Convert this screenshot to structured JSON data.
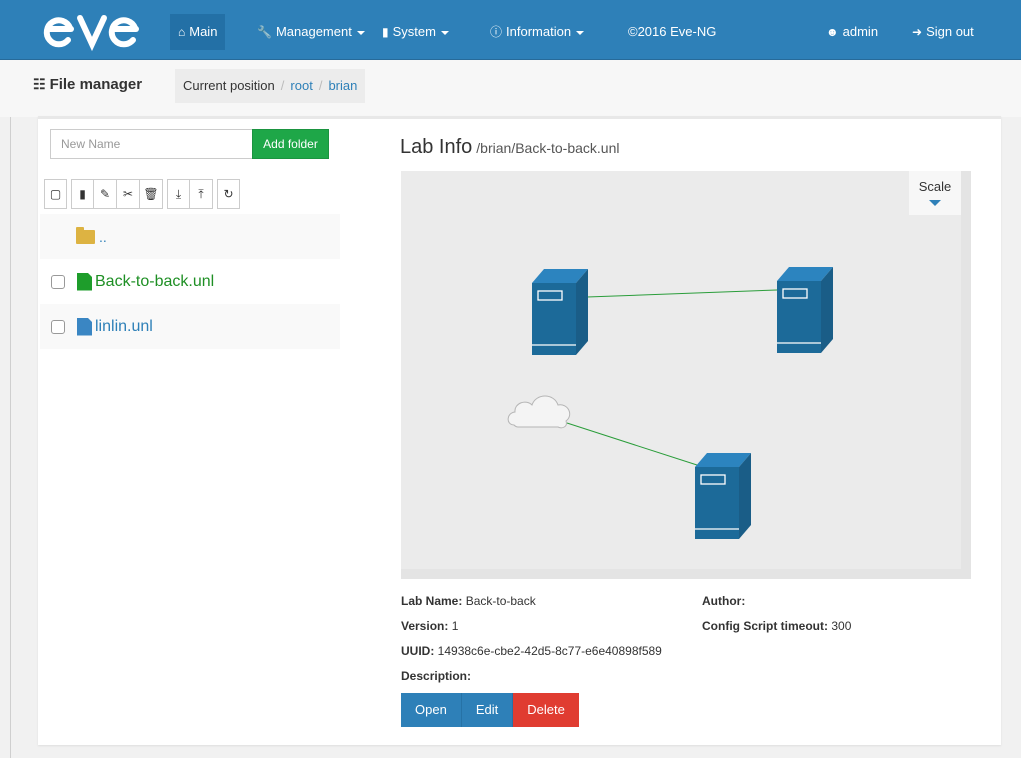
{
  "nav": {
    "logo": "eve",
    "items": [
      {
        "label": "Main",
        "icon": "home-icon"
      },
      {
        "label": "Management",
        "icon": "wrench-icon"
      },
      {
        "label": "System",
        "icon": "book-icon"
      },
      {
        "label": "Information",
        "icon": "info-icon"
      }
    ],
    "copyright": "©2016 Eve-NG",
    "user": "admin",
    "signout": "Sign out"
  },
  "header": {
    "title": "File manager",
    "breadcrumb": {
      "label": "Current position",
      "items": [
        "root",
        "brian"
      ]
    }
  },
  "files": {
    "new_name_placeholder": "New Name",
    "add_folder_label": "Add folder",
    "up_label": "..",
    "items": [
      {
        "name": "Back-to-back.unl",
        "color": "#1e8f24"
      },
      {
        "name": "linlin.unl",
        "color": "#2e80b8"
      }
    ]
  },
  "lab": {
    "title": "Lab Info",
    "path": "/brian/Back-to-back.unl",
    "scale_label": "Scale",
    "name_label": "Lab Name:",
    "name": "Back-to-back",
    "version_label": "Version:",
    "version": "1",
    "uuid_label": "UUID:",
    "uuid": "14938c6e-cbe2-42d5-8c77-e6e40898f589",
    "description_label": "Description:",
    "author_label": "Author:",
    "timeout_label": "Config Script timeout:",
    "timeout": "300",
    "buttons": {
      "open": "Open",
      "edit": "Edit",
      "delete": "Delete"
    }
  },
  "colors": {
    "navbar": "#2e80b8",
    "success": "#1ea748",
    "danger": "#e03c31",
    "device": "#1c6a99"
  }
}
